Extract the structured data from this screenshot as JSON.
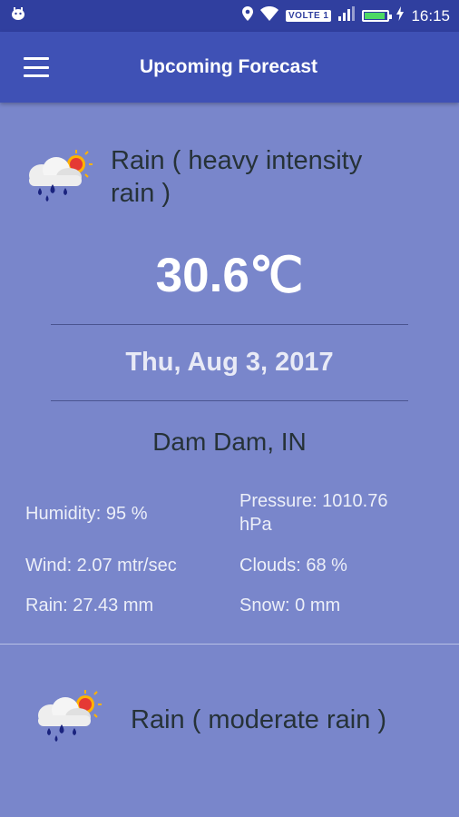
{
  "status_bar": {
    "network_badge": "VOLTE 1",
    "time": "16:15",
    "battery_level": 0.9,
    "icons": [
      "notification-icon",
      "location-icon",
      "wifi-icon",
      "signal-icon",
      "battery-icon",
      "charging-icon"
    ]
  },
  "app_bar": {
    "title": "Upcoming Forecast",
    "menu_icon": "hamburger-menu-icon"
  },
  "forecasts": [
    {
      "condition": "Rain ( heavy intensity rain )",
      "icon": "rain-sun-cloud-icon",
      "temperature": "30.6℃",
      "date": "Thu, Aug 3, 2017",
      "location": "Dam Dam, IN",
      "humidity": "Humidity: 95 %",
      "pressure": "Pressure: 1010.76 hPa",
      "wind": "Wind: 2.07 mtr/sec",
      "clouds": "Clouds: 68 %",
      "rain": "Rain: 27.43 mm",
      "snow": "Snow: 0 mm"
    },
    {
      "condition": "Rain ( moderate rain )",
      "icon": "rain-sun-cloud-icon"
    }
  ],
  "colors": {
    "status_bar": "#303f9f",
    "app_bar": "#3f51b5",
    "background": "#7986cb"
  }
}
